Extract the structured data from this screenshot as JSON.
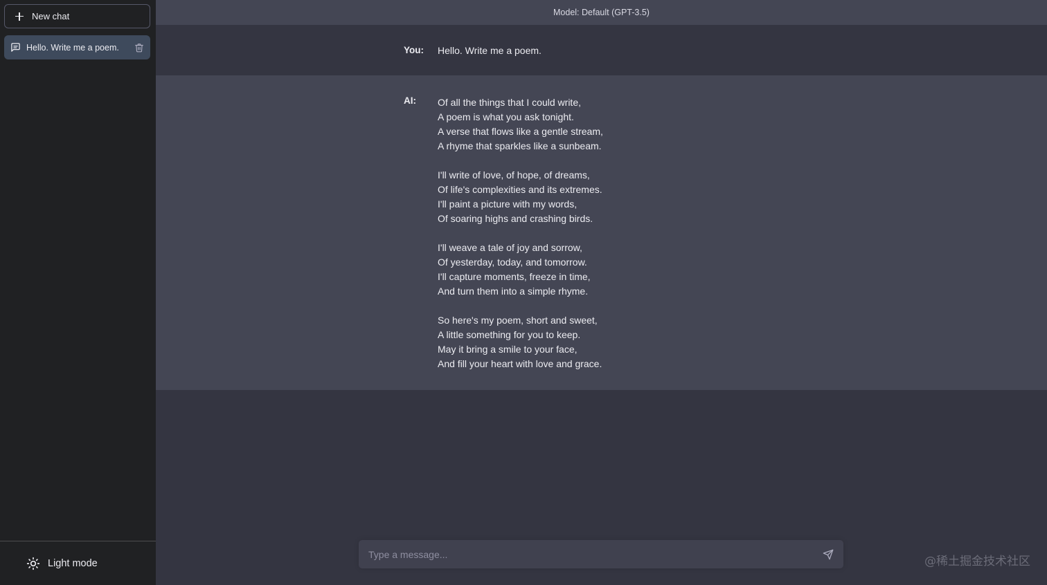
{
  "sidebar": {
    "new_chat_label": "New chat",
    "conversations": [
      {
        "title": "Hello. Write me a poem."
      }
    ],
    "footer_label": "Light mode"
  },
  "header": {
    "model_label": "Model: Default (GPT-3.5)"
  },
  "messages": {
    "user": {
      "role": "You:",
      "text": "Hello. Write me a poem."
    },
    "ai": {
      "role": "AI:",
      "text": "Of all the things that I could write,\nA poem is what you ask tonight.\nA verse that flows like a gentle stream,\nA rhyme that sparkles like a sunbeam.\n\nI'll write of love, of hope, of dreams,\nOf life's complexities and its extremes.\nI'll paint a picture with my words,\nOf soaring highs and crashing birds.\n\nI'll weave a tale of joy and sorrow,\nOf yesterday, today, and tomorrow.\nI'll capture moments, freeze in time,\nAnd turn them into a simple rhyme.\n\nSo here's my poem, short and sweet,\nA little something for you to keep.\nMay it bring a smile to your face,\nAnd fill your heart with love and grace."
    }
  },
  "composer": {
    "placeholder": "Type a message...",
    "value": ""
  },
  "watermark": "@稀土掘金技术社区",
  "colors": {
    "sidebar_bg": "#202123",
    "main_bg": "#343541",
    "ai_bg": "#444654",
    "active_item_bg": "#3e4a5c",
    "input_bg": "#40414f"
  }
}
